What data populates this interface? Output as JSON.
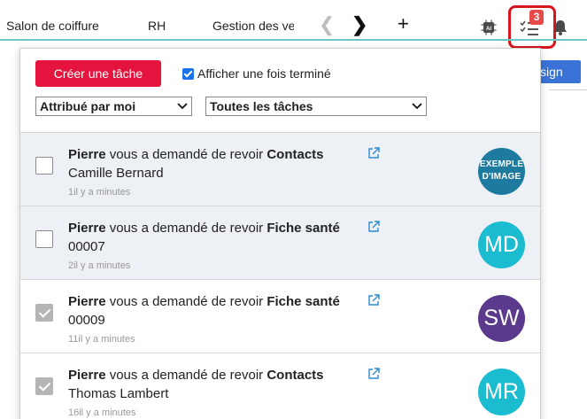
{
  "nav": {
    "tabs": [
      "Salon de coiffure",
      "RH",
      "Gestion des ve"
    ],
    "prev_arrow": "❮",
    "next_arrow": "❯",
    "add": "+",
    "tasks_badge": "3"
  },
  "background": {
    "button_label": "sign"
  },
  "panel": {
    "create_button": "Créer une tâche",
    "show_done_label": "Afficher une fois terminé",
    "show_done_checked": true,
    "filter_assigned": "Attribué par moi",
    "filter_tasks": "Toutes les tâches"
  },
  "tasks": [
    {
      "requester": "Pierre",
      "text": " vous a demandé de revoir ",
      "subject": "Contacts",
      "target": "Camille Bernard",
      "time": "1il y a   minutes",
      "done": false,
      "avatar": "EXEMPLE D'IMAGE",
      "avatar_color": "#1e7a9e"
    },
    {
      "requester": "Pierre",
      "text": " vous a demandé de revoir ",
      "subject": "Fiche santé",
      "target": "00007",
      "time": "2il y a   minutes",
      "done": false,
      "avatar": "MD",
      "avatar_color": "#1bbcd0"
    },
    {
      "requester": "Pierre",
      "text": " vous a demandé de revoir ",
      "subject": "Fiche santé",
      "target": "00009",
      "time": "11il y a   minutes",
      "done": true,
      "avatar": "SW",
      "avatar_color": "#5b3a8e"
    },
    {
      "requester": "Pierre",
      "text": " vous a demandé de revoir ",
      "subject": "Contacts",
      "target": "Thomas Lambert",
      "time": "16il y a   minutes",
      "done": true,
      "avatar": "MR",
      "avatar_color": "#1bbcd0"
    }
  ],
  "colors": {
    "accent_red": "#e5143e",
    "highlight_border": "#d8151d",
    "teal_line": "#69c7c4",
    "link_blue": "#2a8ccf"
  }
}
